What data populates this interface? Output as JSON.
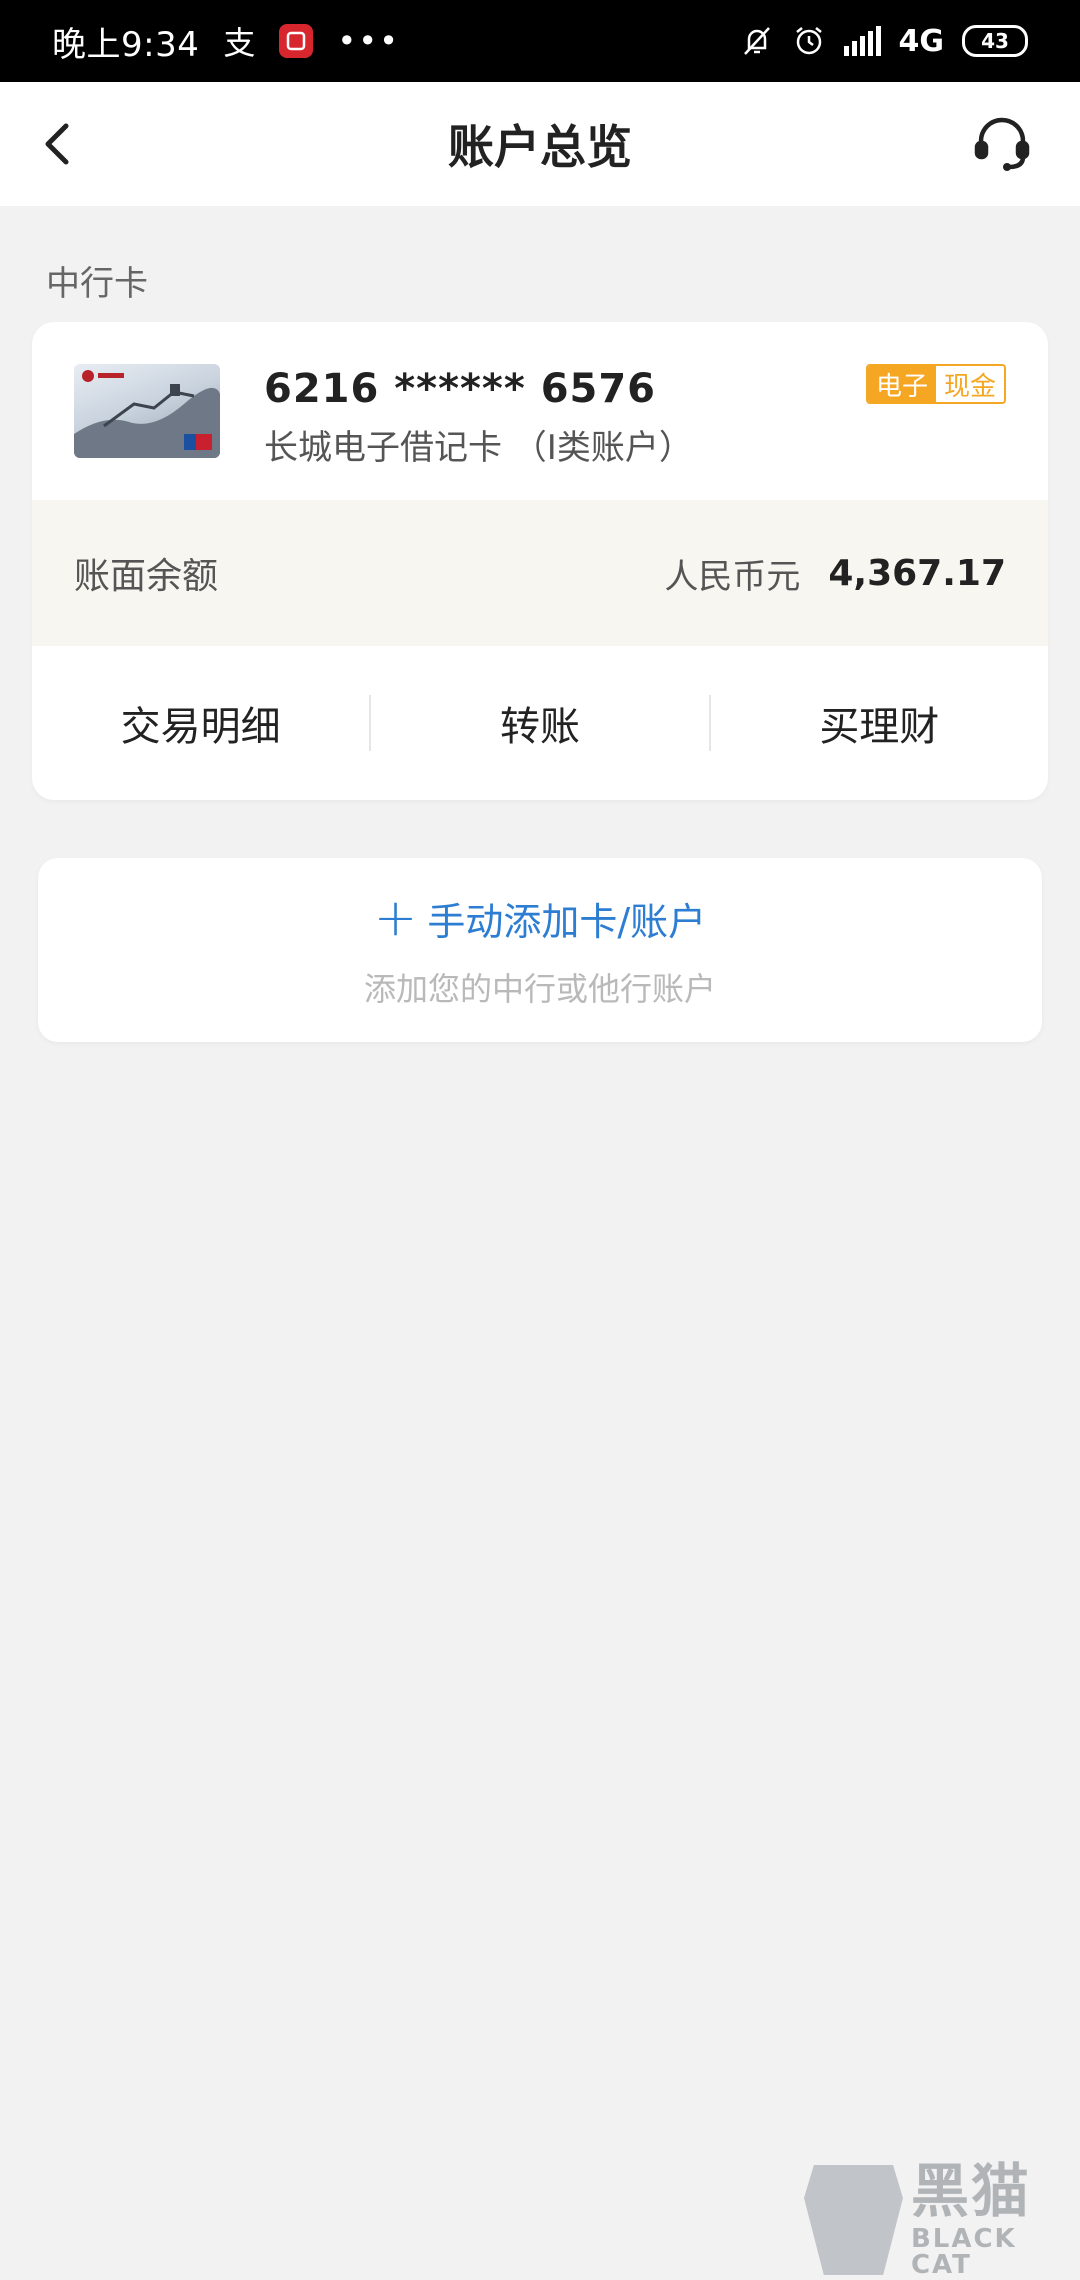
{
  "status_bar": {
    "time": "晚上9:34",
    "pay_icon_char": "支",
    "more": "•••",
    "network": "4G",
    "battery": "43"
  },
  "header": {
    "title": "账户总览",
    "back_icon": "chevron-left-icon",
    "support_icon": "headset-icon"
  },
  "section": {
    "label": "中行卡"
  },
  "account": {
    "card_number": "6216 ****** 6576",
    "card_name": "长城电子借记卡 （I类账户）",
    "badge_left": "电子",
    "badge_right": "现金",
    "balance_label": "账面余额",
    "currency": "人民币元",
    "balance": "4,367.17",
    "actions": [
      {
        "label": "交易明细"
      },
      {
        "label": "转账"
      },
      {
        "label": "买理财"
      }
    ]
  },
  "add_account": {
    "plus": "+",
    "title": "手动添加卡/账户",
    "subtitle": "添加您的中行或他行账户"
  },
  "watermark": {
    "zh": "黑猫",
    "en": "BLACK CAT"
  },
  "colors": {
    "accent_blue": "#2d7dd2",
    "badge_orange": "#f5a623",
    "background": "#f2f2f2"
  }
}
